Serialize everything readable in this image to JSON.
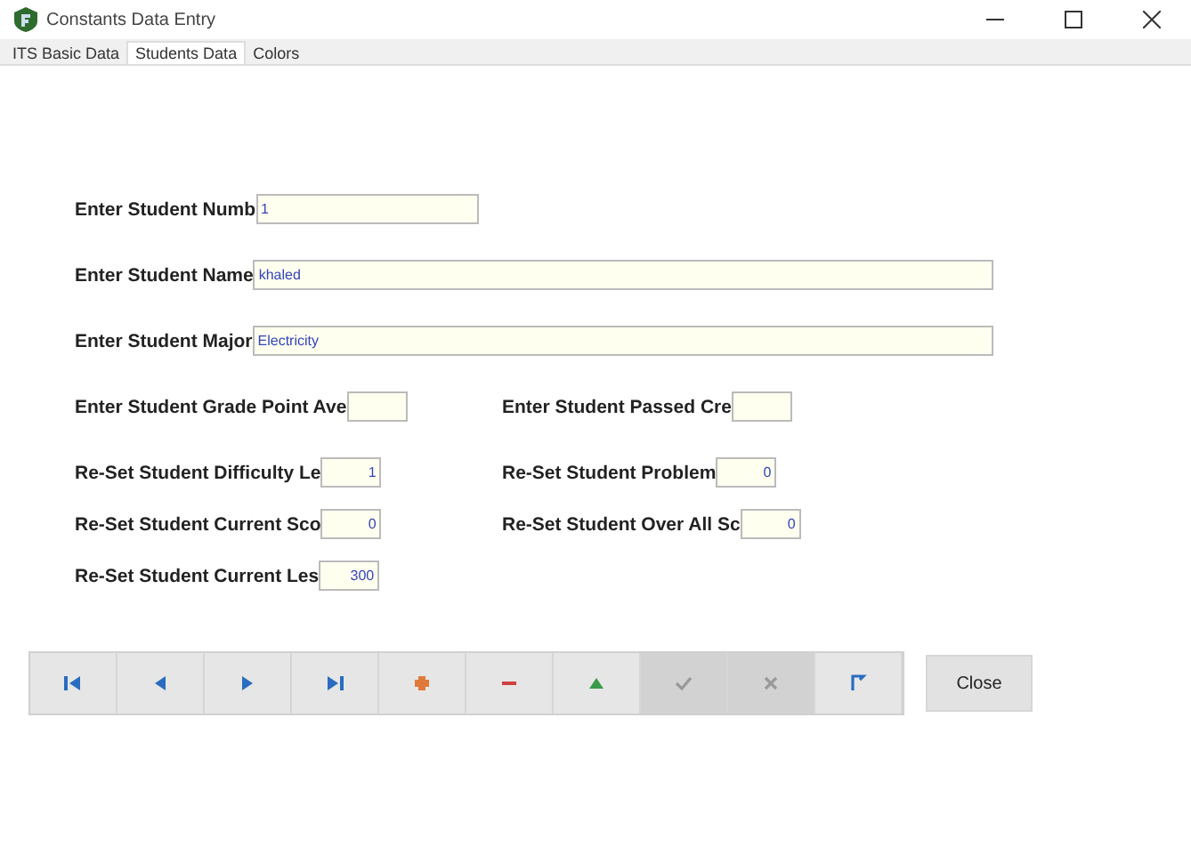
{
  "window": {
    "title": "Constants Data Entry"
  },
  "tabs": [
    {
      "label": "ITS Basic Data",
      "selected": false
    },
    {
      "label": "Students Data",
      "selected": true
    },
    {
      "label": "Colors",
      "selected": false
    }
  ],
  "form_rows": [
    [
      {
        "label": "Enter Student Numb",
        "value": "1",
        "kind": "short"
      }
    ],
    [
      {
        "label": "Enter Student Name",
        "value": "khaled",
        "kind": "wide"
      }
    ],
    [
      {
        "label": "Enter Student Major",
        "value": "Electricity",
        "kind": "wide"
      }
    ],
    [
      {
        "label": "Enter Student Grade Point Ave",
        "kind": "small"
      },
      {
        "label": "Enter Student Passed Cre",
        "kind": "small"
      }
    ],
    [
      {
        "label": "Re-Set Student Difficulty Le",
        "value": "1",
        "kind": "tiny"
      },
      {
        "label": "Re-Set Student Problem",
        "value": "0",
        "kind": "tiny"
      }
    ],
    [
      {
        "label": "Re-Set Student Current Sco",
        "value": "0",
        "kind": "tiny"
      },
      {
        "label": "Re-Set Student Over All Sc",
        "value": "0",
        "kind": "tiny"
      }
    ],
    [
      {
        "label": "Re-Set Student Current Les",
        "value": "300",
        "kind": "tiny"
      }
    ]
  ],
  "toolbar": [
    {
      "kind": "first",
      "disabled": false
    },
    {
      "kind": "prev",
      "disabled": false
    },
    {
      "kind": "next",
      "disabled": false
    },
    {
      "kind": "last",
      "disabled": false
    },
    {
      "kind": "add",
      "disabled": false
    },
    {
      "kind": "delete",
      "disabled": false
    },
    {
      "kind": "edit",
      "disabled": false
    },
    {
      "kind": "post",
      "disabled": true
    },
    {
      "kind": "cancel",
      "disabled": true
    },
    {
      "kind": "refresh",
      "disabled": false
    }
  ],
  "close_button": "Close"
}
